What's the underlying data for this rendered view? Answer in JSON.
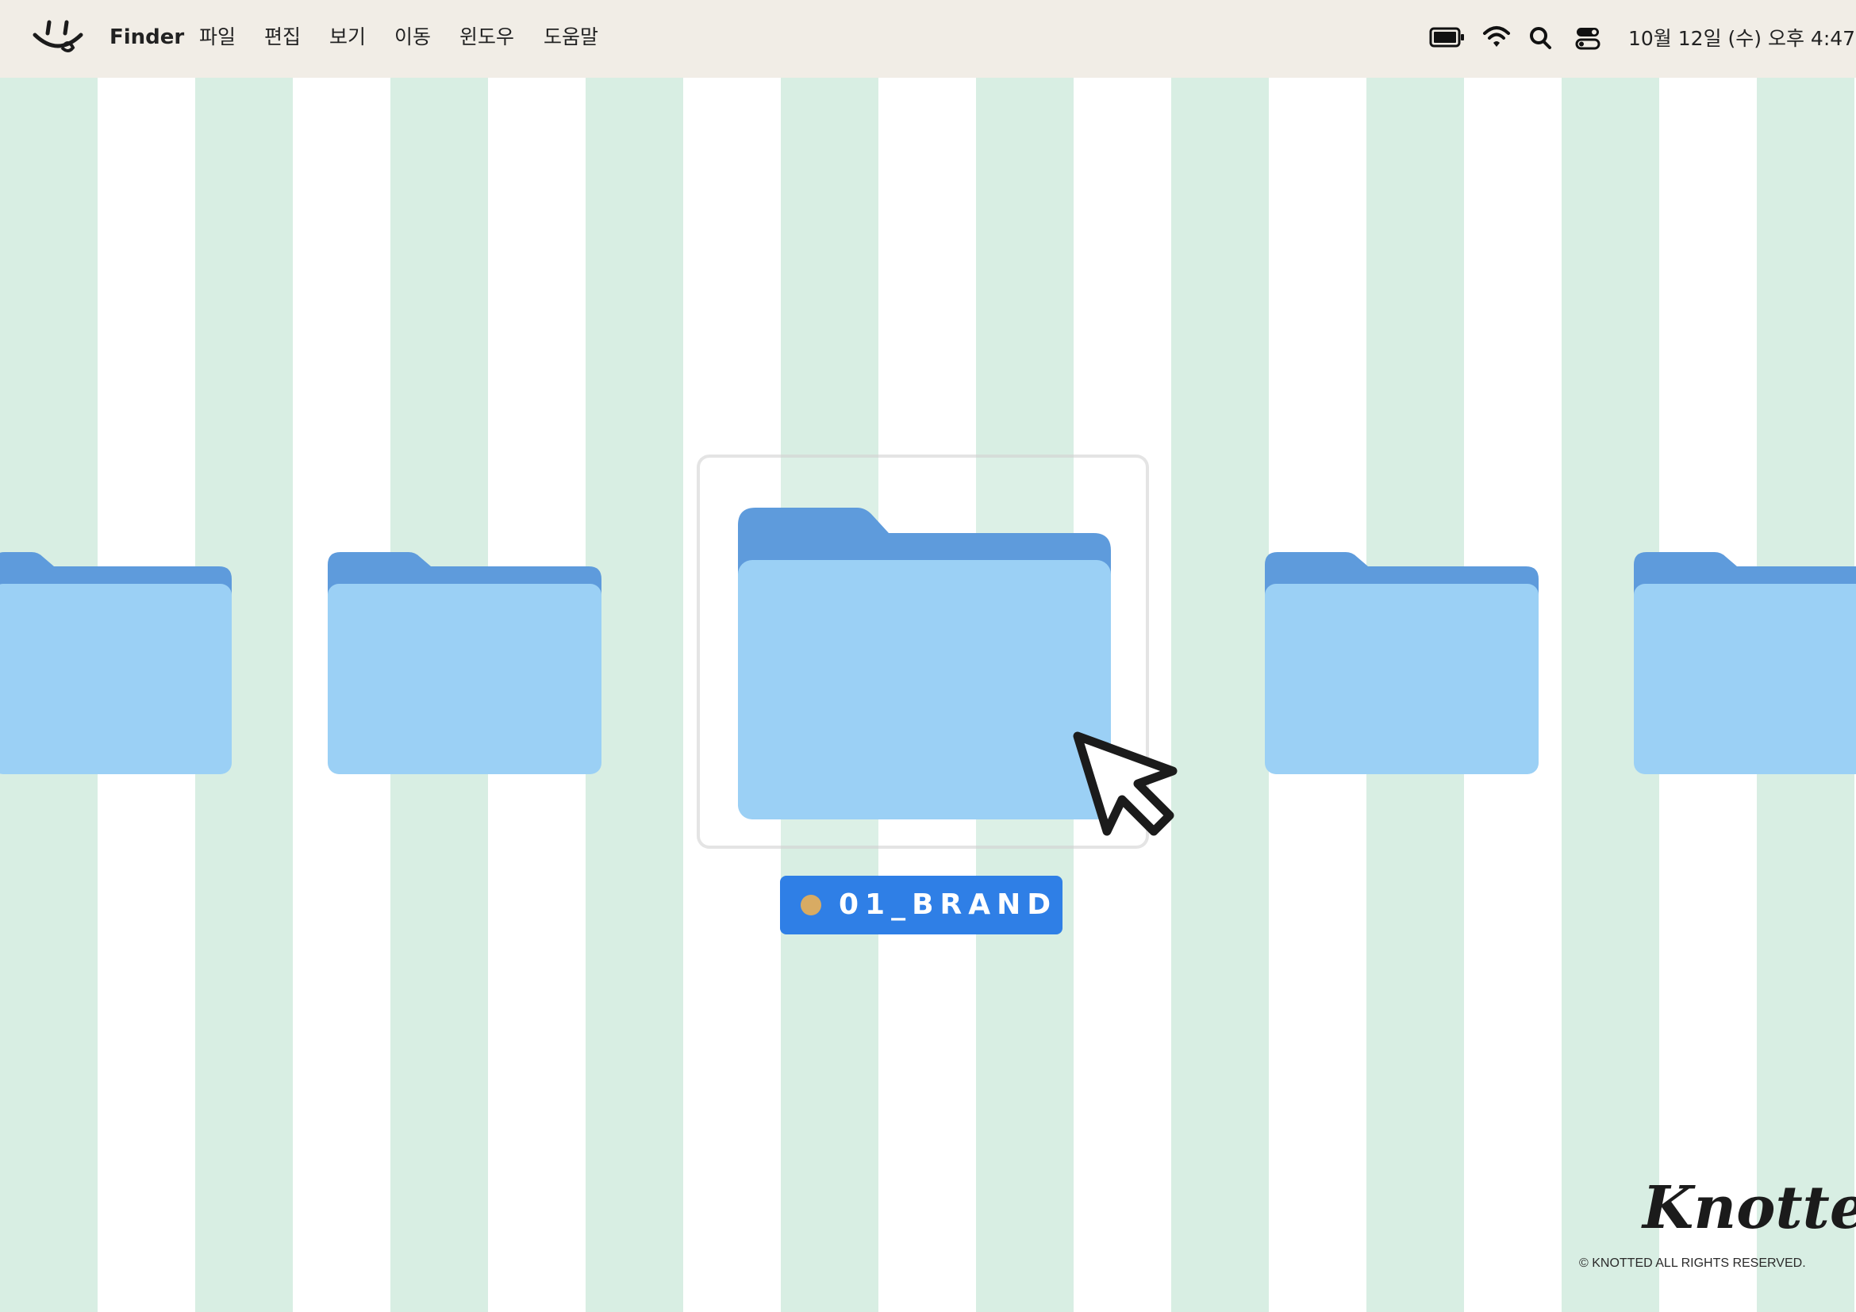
{
  "menubar": {
    "app_name": "Finder",
    "items": [
      "파일",
      "편집",
      "보기",
      "이동",
      "윈도우",
      "도움말"
    ],
    "status": {
      "icons": [
        "battery-icon",
        "wifi-icon",
        "search-icon",
        "control-center-icon"
      ],
      "clock": "10월 12일 (수) 오후 4:47"
    }
  },
  "desktop": {
    "stripe_colors": [
      "#d8eee3",
      "#ffffff"
    ],
    "selected_folder": {
      "label": "01_BRAND",
      "tag_color": "#d8ab63",
      "label_bg": "#2f7fe6"
    },
    "folder_colors": {
      "body": "#9bd0f5",
      "tab": "#5e9bdc"
    }
  },
  "branding": {
    "logo_text": "Knotted.",
    "copyright": "© KNOTTED ALL RIGHTS RESERVED."
  }
}
